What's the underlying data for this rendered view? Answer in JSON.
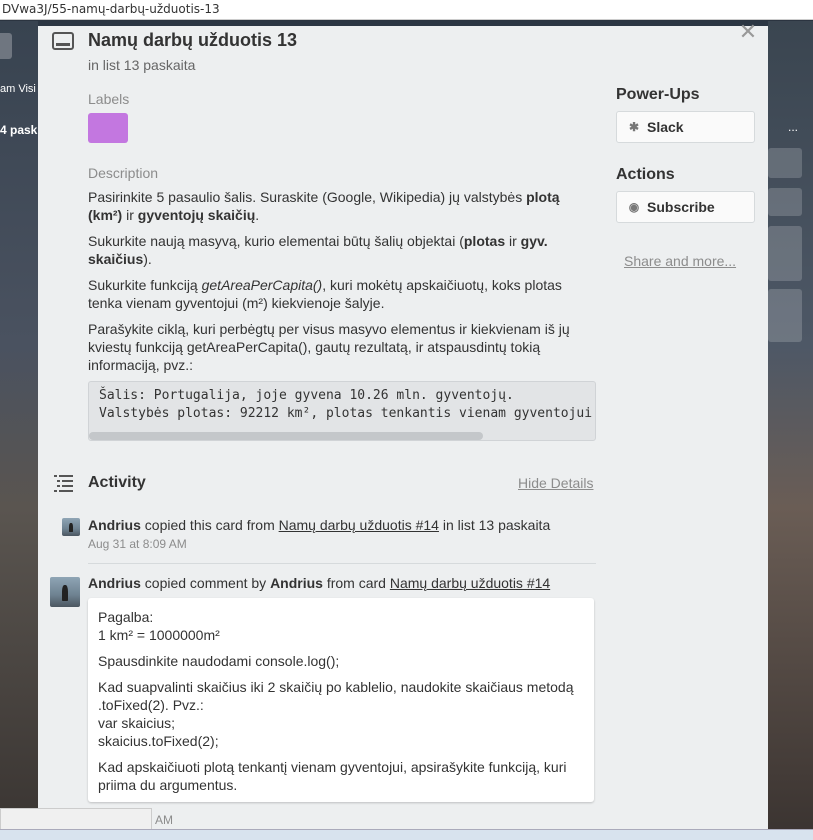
{
  "browser": {
    "url_fragment": "DVwa3J/55-namų-darbų-užduotis-13"
  },
  "background": {
    "left_text_1": "am Visi",
    "left_text_2": "4 pask",
    "right_dots": "...",
    "bottom_time": "AM"
  },
  "card": {
    "title": "Namų darbų užduotis 13",
    "in_list": "in list 13 paskaita",
    "labels_heading": "Labels",
    "label_color": "#c377e0",
    "description_heading": "Description",
    "description": {
      "p1_a": "Pasirinkite 5 pasaulio šalis. Suraskite (Google, Wikipedia) jų valstybės ",
      "p1_b": "plotą (km²)",
      "p1_c": " ir ",
      "p1_d": "gyventojų skaičių",
      "p1_e": ".",
      "p2_a": "Sukurkite naują masyvą, kurio elementai būtų šalių objektai (",
      "p2_b": "plotas",
      "p2_c": " ir ",
      "p2_d": "gyv. skaičius",
      "p2_e": ").",
      "p3_a": "Sukurkite funkciją ",
      "p3_b": "getAreaPerCapita()",
      "p3_c": ", kuri mokėtų apskaičiuotų, koks plotas tenka vienam gyventojui (m²) kiekvienoje šalyje.",
      "p4": "Parašykite ciklą, kuri perbėgtų per visus masyvo elementus ir kiekvienam iš jų kviestų funkciją getAreaPerCapita(), gautų rezultatą, ir atspausdintų tokią informaciją, pvz.:",
      "code_line1": "Šalis: Portugalija, joje gyvena 10.26 mln. gyventojų.",
      "code_line2": "Valstybės plotas: 92212 km², plotas tenkantis vienam gyventojui"
    }
  },
  "activity": {
    "title": "Activity",
    "hide_details": "Hide Details",
    "items": [
      {
        "author": "Andrius",
        "text_a": " copied this card from ",
        "link": "Namų darbų užduotis #14",
        "text_b": " in list 13 paskaita",
        "time": "Aug 31 at 8:09 AM"
      },
      {
        "author": "Andrius",
        "text_a": " copied comment by ",
        "author2": "Andrius",
        "text_b": " from card ",
        "link": "Namų darbų užduotis #14",
        "comment": {
          "l1": "Pagalba:",
          "l2": "1 km² = 1000000m²",
          "l3": "Spausdinkite naudodami console.log();",
          "l4": "Kad suapvalinti skaičius iki 2 skaičių po kablelio, naudokite skaičiaus metodą .toFixed(2). Pvz.:",
          "l5": "var skaicius;",
          "l6": "skaicius.toFixed(2);",
          "l7": "Kad apskaičiuoti plotą tenkantį vienam gyventojui, apsirašykite funkciją, kuri priima du argumentus."
        }
      }
    ]
  },
  "sidebar": {
    "powerups_title": "Power-Ups",
    "slack_label": "Slack",
    "actions_title": "Actions",
    "subscribe_label": "Subscribe",
    "share_label": "Share and more..."
  },
  "icons": {
    "close": "close-icon",
    "card": "card-icon",
    "activity": "activity-list-icon",
    "slack": "slack-icon",
    "subscribe": "eye-icon"
  }
}
